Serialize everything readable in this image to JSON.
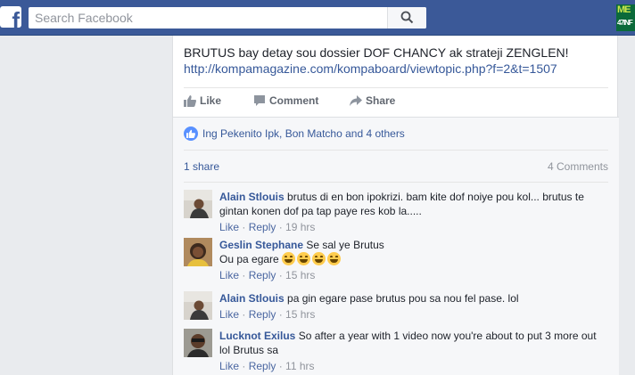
{
  "header": {
    "logo_letter": "f",
    "search_placeholder": "Search Facebook",
    "corner_thumb_line1": "ME",
    "corner_thumb_line2": "47INF"
  },
  "post": {
    "text": "BRUTUS bay detay sou dossier DOF CHANCY ak strateji ZENGLEN!",
    "link": "http://kompamagazine.com/kompaboard/viewtopic.php?f=2&t=1507",
    "actions": {
      "like": "Like",
      "comment": "Comment",
      "share": "Share"
    },
    "reactions_text": "Ing Pekenito Ipk, Bon Matcho and 4 others",
    "shares_text": "1 share",
    "comments_count": "4 Comments"
  },
  "comments": [
    {
      "author": "Alain Stlouis",
      "text": "brutus di en bon ipokrizi. bam kite dof noiye pou kol... brutus te gintan konen dof pa tap paye res kob la.....",
      "like": "Like",
      "reply": "Reply",
      "time": "19 hrs"
    },
    {
      "author": "Geslin Stephane",
      "text": "Se sal ye Brutus",
      "text2": "Ou pa egare",
      "emoji": [
        "laughing-face",
        "laughing-face",
        "laughing-face",
        "laughing-face"
      ],
      "like": "Like",
      "reply": "Reply",
      "time": "15 hrs"
    },
    {
      "author": "Alain Stlouis",
      "text": "pa gin egare pase brutus pou sa nou fel pase. lol",
      "like": "Like",
      "reply": "Reply",
      "time": "15 hrs"
    },
    {
      "author": "Lucknot Exilus",
      "text": "So after a year with 1 video now you're about to put 3 more out lol Brutus sa",
      "like": "Like",
      "reply": "Reply",
      "time": "11 hrs"
    }
  ],
  "colors": {
    "topbar": "#3b5998",
    "link": "#365899",
    "meta": "#90949c",
    "background": "#e9ebee"
  }
}
